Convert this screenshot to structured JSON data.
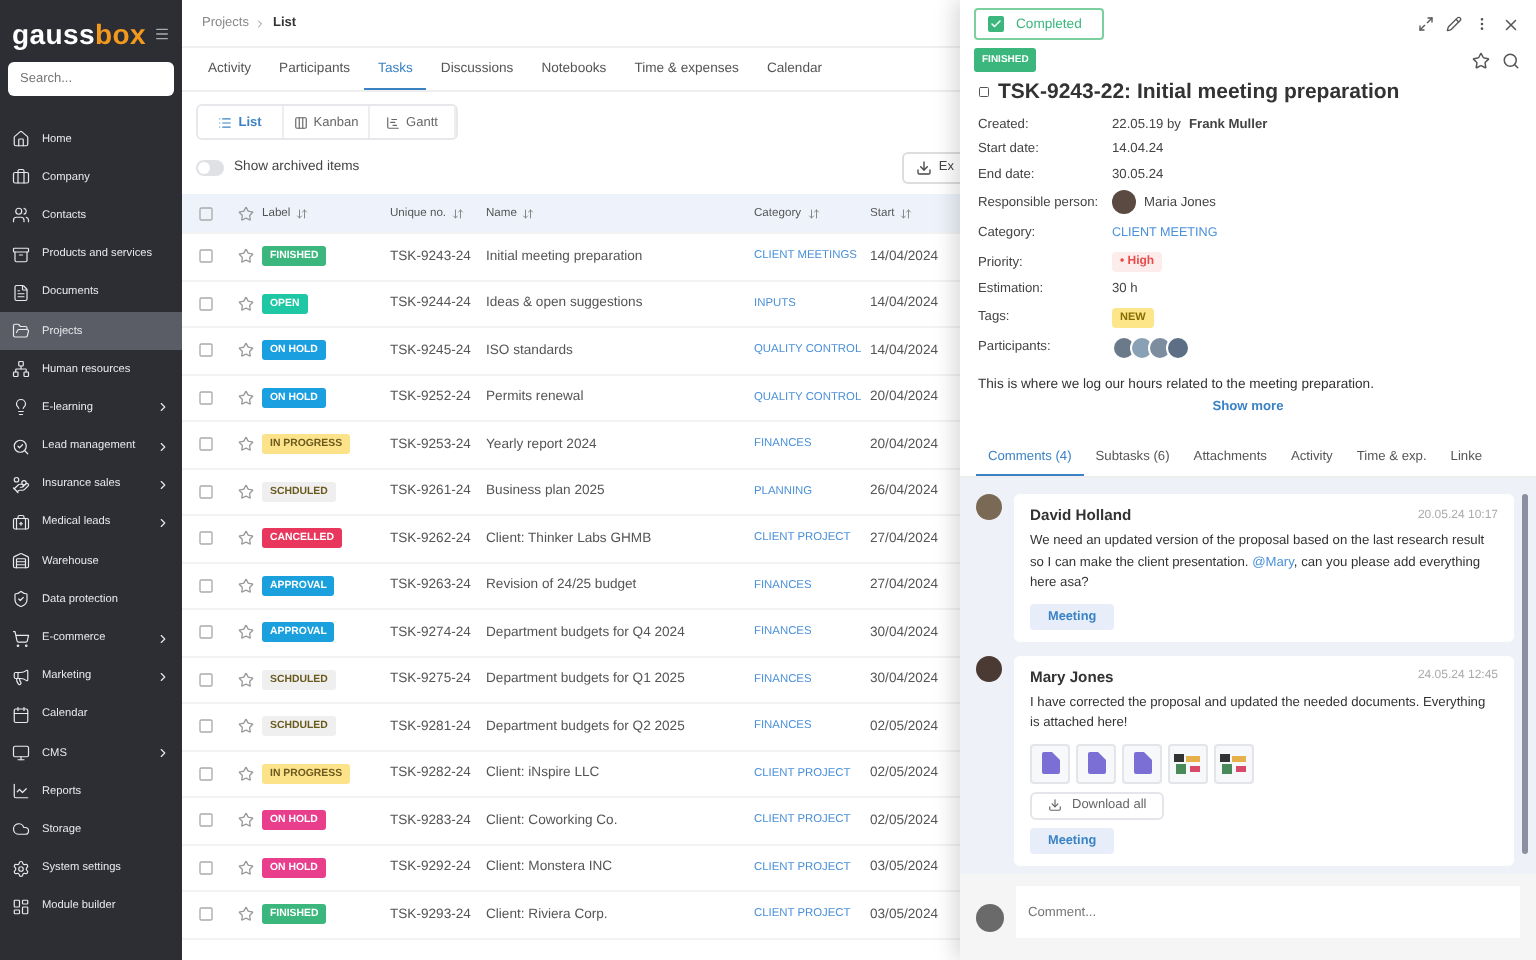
{
  "sidebar": {
    "logo": {
      "part_1": "gauss",
      "part_2": "box"
    },
    "search": {
      "placeholder": "Search..."
    },
    "items": [
      {
        "label": "Home",
        "selected": false,
        "expandable": false
      },
      {
        "label": "Company",
        "selected": false,
        "expandable": false
      },
      {
        "label": "Contacts",
        "selected": false,
        "expandable": false
      },
      {
        "label": "Products and services",
        "selected": false,
        "expandable": false
      },
      {
        "label": "Documents",
        "selected": false,
        "expandable": false
      },
      {
        "label": "Projects",
        "selected": true,
        "expandable": false
      },
      {
        "label": "Human resources",
        "selected": false,
        "expandable": false
      },
      {
        "label": "E-learning",
        "selected": false,
        "expandable": true
      },
      {
        "label": "Lead management",
        "selected": false,
        "expandable": true
      },
      {
        "label": "Insurance sales",
        "selected": false,
        "expandable": true
      },
      {
        "label": "Medical leads",
        "selected": false,
        "expandable": true
      },
      {
        "label": "Warehouse",
        "selected": false,
        "expandable": false
      },
      {
        "label": "Data protection",
        "selected": false,
        "expandable": false
      },
      {
        "label": "E-commerce",
        "selected": false,
        "expandable": true
      },
      {
        "label": "Marketing",
        "selected": false,
        "expandable": true
      },
      {
        "label": "Calendar",
        "selected": false,
        "expandable": false
      },
      {
        "label": "CMS",
        "selected": false,
        "expandable": true
      },
      {
        "label": "Reports",
        "selected": false,
        "expandable": false
      },
      {
        "label": "Storage",
        "selected": false,
        "expandable": false
      },
      {
        "label": "System settings",
        "selected": false,
        "expandable": false
      },
      {
        "label": "Module builder",
        "selected": false,
        "expandable": false
      }
    ]
  },
  "breadcrumb": [
    "Projects",
    "List"
  ],
  "tabs": [
    {
      "label": "Activity",
      "selected": false
    },
    {
      "label": "Participants",
      "selected": false
    },
    {
      "label": "Tasks",
      "selected": true
    },
    {
      "label": "Discussions",
      "selected": false
    },
    {
      "label": "Notebooks",
      "selected": false
    },
    {
      "label": "Time & expenses",
      "selected": false
    },
    {
      "label": "Calendar",
      "selected": false
    }
  ],
  "views": [
    {
      "label": "List",
      "selected": true
    },
    {
      "label": "Kanban",
      "selected": false
    },
    {
      "label": "Gantt",
      "selected": false
    }
  ],
  "archived_toggle": {
    "label": "Show archived items",
    "on": false
  },
  "export_button": "Ex",
  "table": {
    "select_all_checked": false,
    "columns": [
      "Label",
      "Unique no.",
      "Name",
      "Category",
      "Start"
    ],
    "rows": [
      {
        "checked": false,
        "starred": false,
        "label": {
          "text": "FINISHED",
          "color": "#3bb77e",
          "kind": "solid"
        },
        "number": "TSK-9243-24",
        "name": "Initial meeting preparation",
        "category": "CLIENT MEETINGS",
        "start": "14/04/2024"
      },
      {
        "checked": false,
        "starred": false,
        "label": {
          "text": "OPEN",
          "color": "#1ec8a5",
          "kind": "solid"
        },
        "number": "TSK-9244-24",
        "name": "Ideas & open suggestions",
        "category": "INPUTS",
        "start": "14/04/2024"
      },
      {
        "checked": false,
        "starred": false,
        "label": {
          "text": "ON HOLD",
          "color": "#1a9fe0",
          "kind": "solid"
        },
        "number": "TSK-9245-24",
        "name": "ISO standards",
        "category": "QUALITY CONTROL",
        "start": "14/04/2024"
      },
      {
        "checked": false,
        "starred": false,
        "label": {
          "text": "ON HOLD",
          "color": "#1a9fe0",
          "kind": "solid"
        },
        "number": "TSK-9252-24",
        "name": "Permits renewal",
        "category": "QUALITY CONTROL",
        "start": "20/04/2024"
      },
      {
        "checked": false,
        "starred": false,
        "label": {
          "text": "IN PROGRESS",
          "color": "#fce38a",
          "kind": "soft"
        },
        "number": "TSK-9253-24",
        "name": "Yearly report 2024",
        "category": "FINANCES",
        "start": "20/04/2024"
      },
      {
        "checked": false,
        "starred": false,
        "label": {
          "text": "SCHDULED",
          "color": "#efefef",
          "kind": "soft"
        },
        "number": "TSK-9261-24",
        "name": "Business plan 2025",
        "category": "PLANNING",
        "start": "26/04/2024"
      },
      {
        "checked": false,
        "starred": false,
        "label": {
          "text": "CANCELLED",
          "color": "#e8365d",
          "kind": "solid"
        },
        "number": "TSK-9262-24",
        "name": "Client: Thinker Labs GHMB",
        "category": "CLIENT PROJECT",
        "start": "27/04/2024"
      },
      {
        "checked": false,
        "starred": false,
        "label": {
          "text": "APPROVAL",
          "color": "#1aa0dc",
          "kind": "solid"
        },
        "number": "TSK-9263-24",
        "name": "Revision of 24/25 budget",
        "category": "FINANCES",
        "start": "27/04/2024"
      },
      {
        "checked": false,
        "starred": false,
        "label": {
          "text": "APPROVAL",
          "color": "#1aa0dc",
          "kind": "solid"
        },
        "number": "TSK-9274-24",
        "name": "Department budgets for Q4 2024",
        "category": "FINANCES",
        "start": "30/04/2024"
      },
      {
        "checked": false,
        "starred": false,
        "label": {
          "text": "SCHDULED",
          "color": "#efefef",
          "kind": "soft"
        },
        "number": "TSK-9275-24",
        "name": "Department budgets for Q1 2025",
        "category": "FINANCES",
        "start": "30/04/2024"
      },
      {
        "checked": false,
        "starred": false,
        "label": {
          "text": "SCHDULED",
          "color": "#efefef",
          "kind": "soft"
        },
        "number": "TSK-9281-24",
        "name": "Department budgets for Q2 2025",
        "category": "FINANCES",
        "start": "02/05/2024"
      },
      {
        "checked": false,
        "starred": false,
        "label": {
          "text": "IN PROGRESS",
          "color": "#fce38a",
          "kind": "soft"
        },
        "number": "TSK-9282-24",
        "name": "Client: iNspire LLC",
        "category": "CLIENT PROJECT",
        "start": "02/05/2024"
      },
      {
        "checked": false,
        "starred": false,
        "label": {
          "text": "ON HOLD",
          "color": "#e83e8c",
          "kind": "solid"
        },
        "number": "TSK-9283-24",
        "name": "Client: Coworking Co.",
        "category": "CLIENT PROJECT",
        "start": "02/05/2024"
      },
      {
        "checked": false,
        "starred": false,
        "label": {
          "text": "ON HOLD",
          "color": "#e83e8c",
          "kind": "solid"
        },
        "number": "TSK-9292-24",
        "name": "Client: Monstera INC",
        "category": "CLIENT PROJECT",
        "start": "03/05/2024"
      },
      {
        "checked": false,
        "starred": false,
        "label": {
          "text": "FINISHED",
          "color": "#3bb77e",
          "kind": "solid"
        },
        "number": "TSK-9293-24",
        "name": "Client: Riviera Corp.",
        "category": "CLIENT PROJECT",
        "start": "03/05/2024"
      }
    ]
  },
  "panel": {
    "status_button": {
      "label": "Completed",
      "checked": true
    },
    "badge": "FINISHED",
    "title": "TSK-9243-22: Initial meeting preparation",
    "fields": [
      {
        "kind": "text",
        "label": "Created:",
        "value": "22.05.19 by **Frank Muller**"
      },
      {
        "kind": "text",
        "label": "Start date:",
        "value": "14.04.24"
      },
      {
        "kind": "text",
        "label": "End date:",
        "value": "30.05.24"
      },
      {
        "kind": "person",
        "label": "Responsible person:",
        "value": "Maria Jones"
      },
      {
        "kind": "link",
        "label": "Category:",
        "value": "CLIENT MEETING"
      },
      {
        "kind": "priority",
        "label": "Priority:",
        "value": "• High"
      },
      {
        "kind": "text",
        "label": "Estimation:",
        "value": "30 h"
      },
      {
        "kind": "tag",
        "label": "Tags:",
        "value": "NEW"
      },
      {
        "kind": "avatars",
        "label": "Participants:"
      }
    ],
    "description": "This is where we log our hours related to the meeting preparation.",
    "show_more": "Show more",
    "tabs": [
      {
        "label": "Comments (4)",
        "selected": true
      },
      {
        "label": "Subtasks (6)",
        "selected": false
      },
      {
        "label": "Attachments",
        "selected": false
      },
      {
        "label": "Activity",
        "selected": false
      },
      {
        "label": "Time & exp.",
        "selected": false
      },
      {
        "label": "Linke",
        "selected": false
      }
    ],
    "comments": [
      {
        "author": "David Holland",
        "time": "20.05.24 10:17",
        "text_before": "We need an updated version of the proposal based on the last research result so I can make the client presentation. ",
        "mention": "@Mary",
        "text_after": ", can you please add everything here asa?",
        "tag": "Meeting"
      },
      {
        "author": "Mary Jones",
        "time": "24.05.24 12:45",
        "text_before": "I have corrected the proposal and updated the needed documents. Everything is attached here!",
        "attachments": [
          {
            "kind": "zip"
          },
          {
            "kind": "zip"
          },
          {
            "kind": "zip"
          },
          {
            "kind": "image"
          },
          {
            "kind": "image"
          }
        ],
        "download": "Download all",
        "tag": "Meeting"
      }
    ],
    "comment_input": {
      "placeholder": "Comment..."
    }
  }
}
